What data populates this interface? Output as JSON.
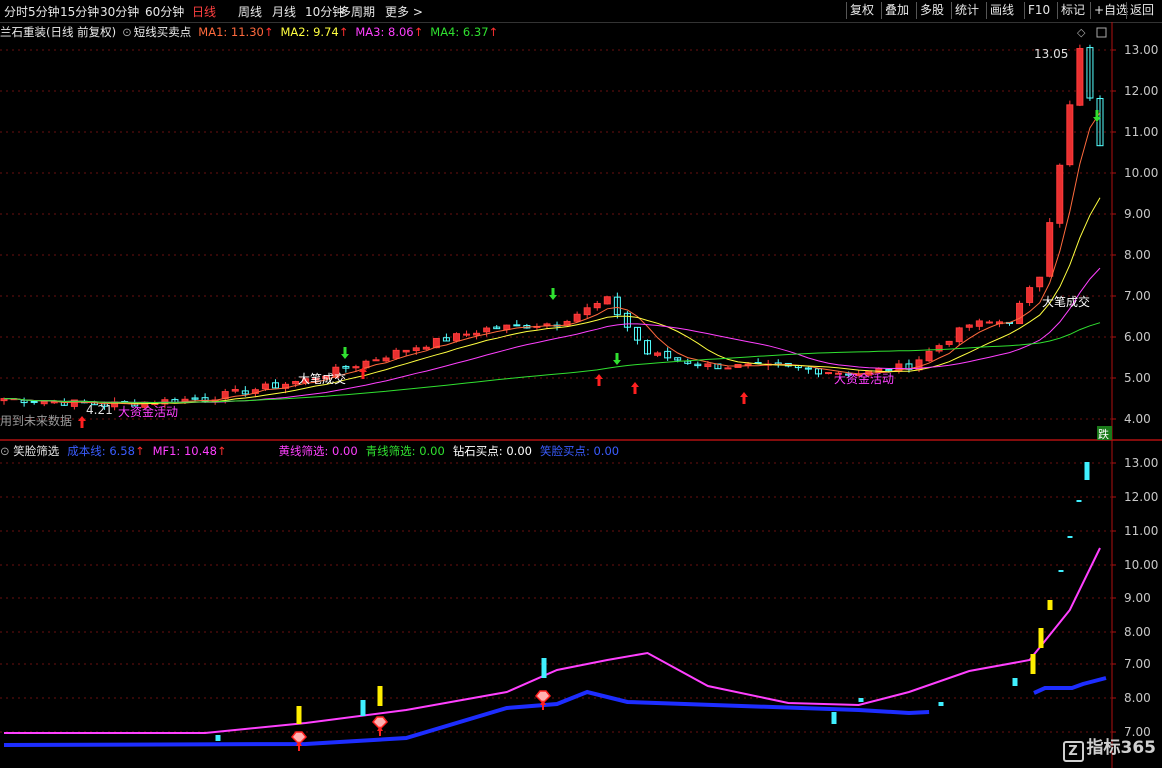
{
  "toolbar": {
    "periods": [
      "分时",
      "5分钟",
      "15分钟",
      "30分钟",
      "60分钟",
      "日线",
      "周线",
      "月线",
      "10分钟",
      "多周期",
      "更多 >"
    ],
    "active_period": "日线",
    "right_buttons": [
      "复权",
      "叠加",
      "多股",
      "统计",
      "画线",
      "F10",
      "标记",
      "+自选",
      "返回"
    ]
  },
  "main_panel": {
    "title": "兰石重装(日线 前复权)",
    "indicator_name": "短线买卖点",
    "ma": [
      {
        "label": "MA1: 11.30",
        "color": "#ff6a3d"
      },
      {
        "label": "MA2: 9.74",
        "color": "#ffff40"
      },
      {
        "label": "MA3: 8.06",
        "color": "#ff40ff"
      },
      {
        "label": "MA4: 6.37",
        "color": "#30e030"
      }
    ],
    "y_axis": [
      "13.00",
      "12.00",
      "11.00",
      "10.00",
      "9.00",
      "8.00",
      "7.00",
      "6.00",
      "5.00",
      "4.00"
    ],
    "high_label": "13.05",
    "low_label": "4.21",
    "future_note": "用到未来数据",
    "annotations": [
      "大笔成交",
      "大资金活动",
      "大资金活动",
      "大笔成交"
    ],
    "drop_badge": "跌"
  },
  "sub_panel": {
    "indicator_name": "笑脸筛选",
    "lines": [
      {
        "label": "成本线: 6.58",
        "color": "#3a5cff"
      },
      {
        "label": "MF1: 10.48",
        "color": "#ff40ff"
      },
      {
        "label": "黄线筛选: 0.00",
        "color": "#ff40ff"
      },
      {
        "label": "青线筛选: 0.00",
        "color": "#30e030"
      },
      {
        "label": "钻石买点: 0.00",
        "color": "#ffffff"
      },
      {
        "label": "笑脸买点: 0.00",
        "color": "#3a5cff"
      }
    ],
    "y_axis": [
      "13.00",
      "12.00",
      "11.00",
      "10.00",
      "9.00",
      "8.00",
      "7.00",
      "8.00",
      "7.00"
    ]
  },
  "logo": "指标365"
}
